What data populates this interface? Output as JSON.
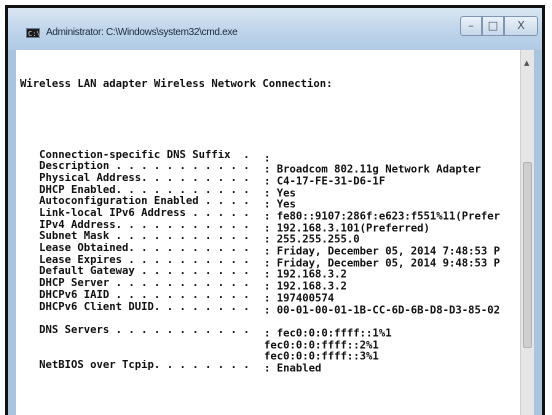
{
  "window": {
    "title": "Administrator: C:\\Windows\\system32\\cmd.exe",
    "icon_text": "C:\\",
    "controls": {
      "minimize": "–",
      "maximize": "□",
      "close": "X"
    }
  },
  "console": {
    "header": "Wireless LAN adapter Wireless Network Connection:",
    "entries": [
      {
        "label": "   Connection-specific DNS Suffix  . ",
        "sep": ": ",
        "value": ""
      },
      {
        "label": "   Description . . . . . . . . . . . ",
        "sep": ": ",
        "value": "Broadcom 802.11g Network Adapter"
      },
      {
        "label": "   Physical Address. . . . . . . . . ",
        "sep": ": ",
        "value": "C4-17-FE-31-D6-1F"
      },
      {
        "label": "   DHCP Enabled. . . . . . . . . . . ",
        "sep": ": ",
        "value": "Yes"
      },
      {
        "label": "   Autoconfiguration Enabled . . . . ",
        "sep": ": ",
        "value": "Yes"
      },
      {
        "label": "   Link-local IPv6 Address . . . . . ",
        "sep": ": ",
        "value": "fe80::9107:286f:e623:f551%11(Prefer"
      },
      {
        "label": "   IPv4 Address. . . . . . . . . . . ",
        "sep": ": ",
        "value": "192.168.3.101(Preferred)"
      },
      {
        "label": "   Subnet Mask . . . . . . . . . . . ",
        "sep": ": ",
        "value": "255.255.255.0"
      },
      {
        "label": "   Lease Obtained. . . . . . . . . . ",
        "sep": ": ",
        "value": "Friday, December 05, 2014 7:48:53 P"
      },
      {
        "label": "   Lease Expires . . . . . . . . . . ",
        "sep": ": ",
        "value": "Friday, December 05, 2014 9:48:53 P"
      },
      {
        "label": "   Default Gateway . . . . . . . . . ",
        "sep": ": ",
        "value": "192.168.3.2"
      },
      {
        "label": "   DHCP Server . . . . . . . . . . . ",
        "sep": ": ",
        "value": "192.168.3.2"
      },
      {
        "label": "   DHCPv6 IAID . . . . . . . . . . . ",
        "sep": ": ",
        "value": "197400574"
      },
      {
        "label": "   DHCPv6 Client DUID. . . . . . . . ",
        "sep": ": ",
        "value": "00-01-00-01-1B-CC-6D-6B-D8-D3-85-02"
      },
      {
        "label": "",
        "sep": "",
        "value": ""
      },
      {
        "label": "   DNS Servers . . . . . . . . . . . ",
        "sep": ": ",
        "value": "fec0:0:0:ffff::1%1"
      },
      {
        "label": "                                       ",
        "sep": "",
        "value": "fec0:0:0:ffff::2%1"
      },
      {
        "label": "                                       ",
        "sep": "",
        "value": "fec0:0:0:ffff::3%1"
      },
      {
        "label": "   NetBIOS over Tcpip. . . . . . . . ",
        "sep": ": ",
        "value": "Enabled"
      }
    ]
  },
  "scrollbar": {
    "up_arrow": "▲"
  },
  "colors": {
    "titlebar": "#bcd3e9",
    "console_bg": "#ffffff",
    "console_text": "#111111"
  }
}
